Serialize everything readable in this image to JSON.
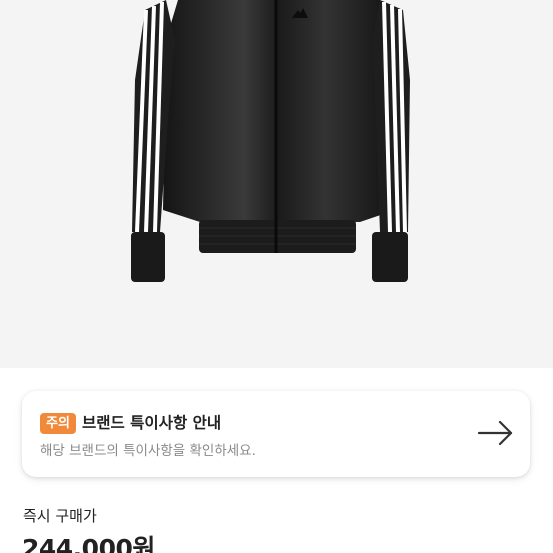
{
  "product": {
    "image_alt": "black track jacket with white stripes"
  },
  "notice": {
    "badge": "주의",
    "title": "브랜드 특이사항 안내",
    "description": "해당 브랜드의 특이사항을 확인하세요.",
    "arrow_icon": "arrow-right-icon",
    "badge_color": "#f08a3a"
  },
  "price": {
    "label": "즉시 구매가",
    "value": "244,000원"
  }
}
